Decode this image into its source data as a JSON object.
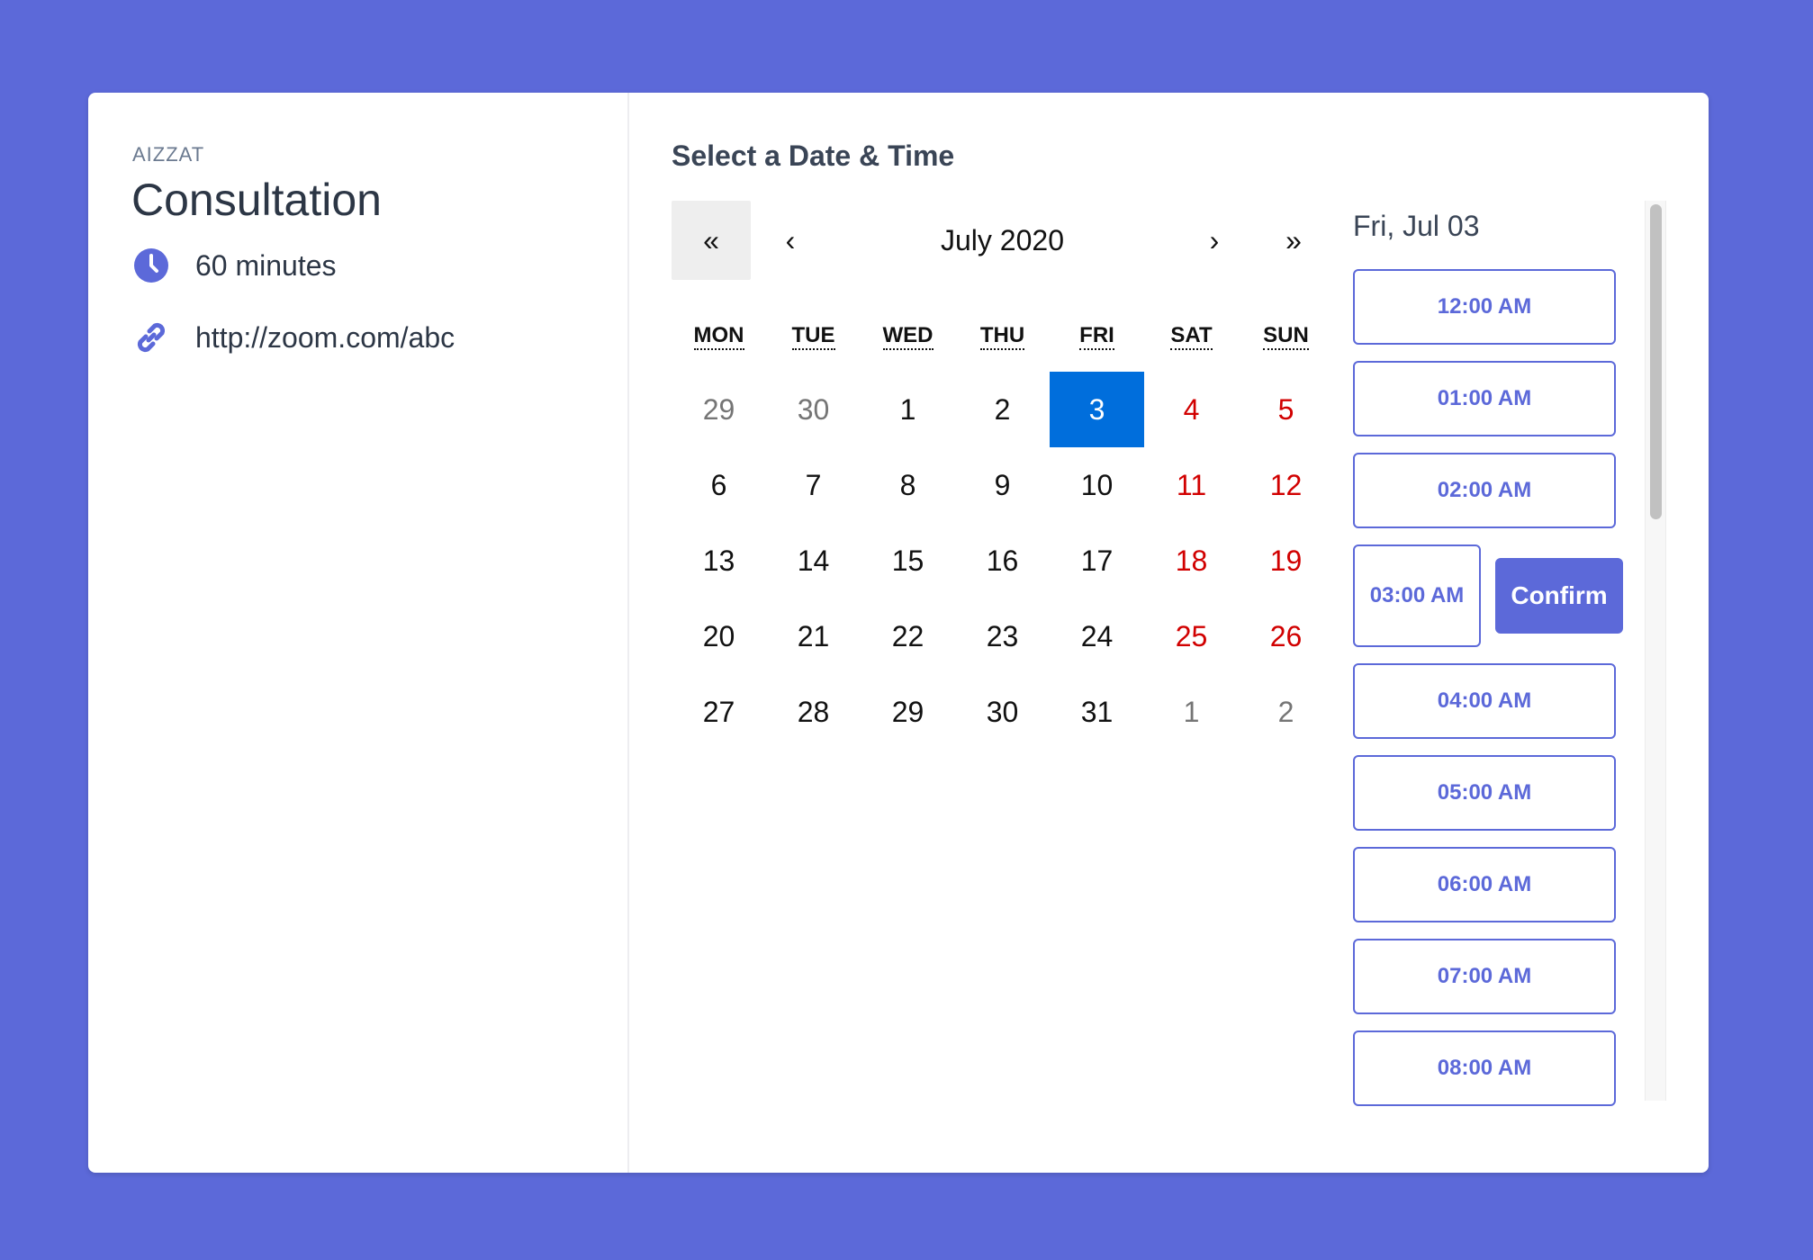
{
  "colors": {
    "accent": "#5c69d9",
    "selected_day": "#006edc",
    "weekend_red": "#d10000",
    "other_month_gray": "#757575"
  },
  "event": {
    "owner": "AIZZAT",
    "title": "Consultation",
    "duration": "60 minutes",
    "duration_icon": "clock-icon",
    "location": "http://zoom.com/abc",
    "location_icon": "link-icon"
  },
  "scheduler": {
    "title": "Select a Date & Time",
    "calendar": {
      "month_label": "July 2020",
      "nav": {
        "double_prev": "«",
        "prev": "‹",
        "next": "›",
        "double_next": "»"
      },
      "weekdays": [
        "MON",
        "TUE",
        "WED",
        "THU",
        "FRI",
        "SAT",
        "SUN"
      ],
      "days": [
        {
          "label": "29",
          "kind": "other"
        },
        {
          "label": "30",
          "kind": "other"
        },
        {
          "label": "1",
          "kind": "normal"
        },
        {
          "label": "2",
          "kind": "normal"
        },
        {
          "label": "3",
          "kind": "selected"
        },
        {
          "label": "4",
          "kind": "weekend"
        },
        {
          "label": "5",
          "kind": "weekend"
        },
        {
          "label": "6",
          "kind": "normal"
        },
        {
          "label": "7",
          "kind": "normal"
        },
        {
          "label": "8",
          "kind": "normal"
        },
        {
          "label": "9",
          "kind": "normal"
        },
        {
          "label": "10",
          "kind": "normal"
        },
        {
          "label": "11",
          "kind": "weekend"
        },
        {
          "label": "12",
          "kind": "weekend"
        },
        {
          "label": "13",
          "kind": "normal"
        },
        {
          "label": "14",
          "kind": "normal"
        },
        {
          "label": "15",
          "kind": "normal"
        },
        {
          "label": "16",
          "kind": "normal"
        },
        {
          "label": "17",
          "kind": "normal"
        },
        {
          "label": "18",
          "kind": "weekend"
        },
        {
          "label": "19",
          "kind": "weekend"
        },
        {
          "label": "20",
          "kind": "normal"
        },
        {
          "label": "21",
          "kind": "normal"
        },
        {
          "label": "22",
          "kind": "normal"
        },
        {
          "label": "23",
          "kind": "normal"
        },
        {
          "label": "24",
          "kind": "normal"
        },
        {
          "label": "25",
          "kind": "weekend"
        },
        {
          "label": "26",
          "kind": "weekend"
        },
        {
          "label": "27",
          "kind": "normal"
        },
        {
          "label": "28",
          "kind": "normal"
        },
        {
          "label": "29",
          "kind": "normal"
        },
        {
          "label": "30",
          "kind": "normal"
        },
        {
          "label": "31",
          "kind": "normal"
        },
        {
          "label": "1",
          "kind": "other"
        },
        {
          "label": "2",
          "kind": "other"
        }
      ]
    },
    "slots": {
      "date_label": "Fri, Jul 03",
      "selected_time": "03:00 AM",
      "confirm_label": "Confirm",
      "times": [
        "12:00 AM",
        "01:00 AM",
        "02:00 AM",
        "03:00 AM",
        "04:00 AM",
        "05:00 AM",
        "06:00 AM",
        "07:00 AM",
        "08:00 AM"
      ]
    }
  }
}
